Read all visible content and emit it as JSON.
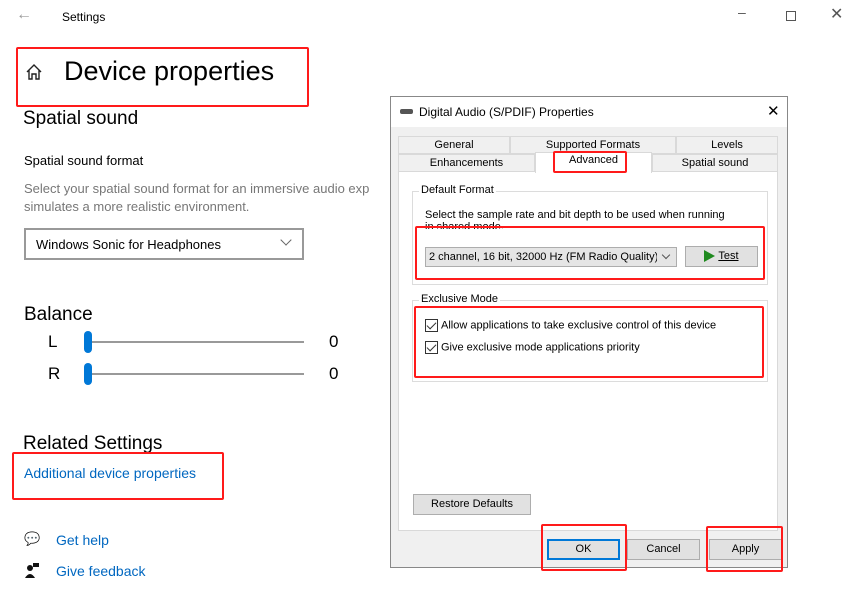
{
  "settings": {
    "window_title": "Settings",
    "page_title": "Device properties",
    "spatial_heading": "Spatial sound",
    "format_label": "Spatial sound format",
    "format_desc_1": "Select your spatial sound format for an immersive audio exp",
    "format_desc_2": "simulates a more realistic environment.",
    "format_value": "Windows Sonic for Headphones",
    "balance_heading": "Balance",
    "balance": [
      {
        "label": "L",
        "value": "0"
      },
      {
        "label": "R",
        "value": "0"
      }
    ],
    "related_heading": "Related Settings",
    "related_link": "Additional device properties",
    "help": "Get help",
    "feedback": "Give feedback"
  },
  "dialog": {
    "title": "Digital Audio (S/PDIF) Properties",
    "tabs_row1": [
      "General",
      "Supported Formats",
      "Levels"
    ],
    "tabs_row2": [
      "Enhancements",
      "Advanced",
      "Spatial sound"
    ],
    "active_tab": "Advanced",
    "default_format": {
      "legend": "Default Format",
      "desc_1": "Select the sample rate and bit depth to be used when running",
      "desc_2": "in shared mode.",
      "value": "2 channel, 16 bit, 32000 Hz (FM Radio Quality)",
      "test": "Test"
    },
    "exclusive": {
      "legend": "Exclusive Mode",
      "options": [
        {
          "label": "Allow applications to take exclusive control of this device",
          "checked": true
        },
        {
          "label": "Give exclusive mode applications priority",
          "checked": true
        }
      ]
    },
    "restore": "Restore Defaults",
    "ok": "OK",
    "cancel": "Cancel",
    "apply": "Apply"
  },
  "colors": {
    "accent": "#0078d7",
    "link": "#0067c0",
    "highlight": "#ff1a1a"
  }
}
